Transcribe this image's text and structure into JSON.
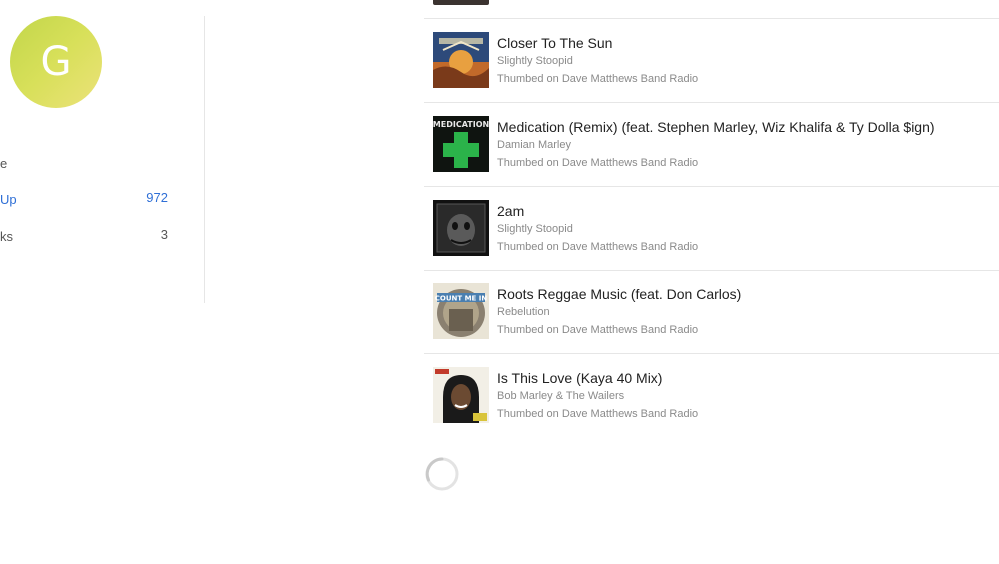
{
  "profile": {
    "initial": "G",
    "avatar_color": "#c9da4f"
  },
  "nav": [
    {
      "label": "e",
      "count": ""
    },
    {
      "label": "Up",
      "count": "972",
      "active": true
    },
    {
      "label": "ks",
      "count": "3"
    }
  ],
  "tracks": [
    {
      "title": "Closer To The Sun",
      "artist": "Slightly Stoopid",
      "meta": "Thumbed on Dave Matthews Band Radio"
    },
    {
      "title": "Medication (Remix) (feat. Stephen Marley, Wiz Khalifa & Ty Dolla $ign)",
      "artist": "Damian Marley",
      "meta": "Thumbed on Dave Matthews Band Radio"
    },
    {
      "title": "2am",
      "artist": "Slightly Stoopid",
      "meta": "Thumbed on Dave Matthews Band Radio"
    },
    {
      "title": "Roots Reggae Music (feat. Don Carlos)",
      "artist": "Rebelution",
      "meta": "Thumbed on Dave Matthews Band Radio"
    },
    {
      "title": "Is This Love (Kaya 40 Mix)",
      "artist": "Bob Marley & The Wailers",
      "meta": "Thumbed on Dave Matthews Band Radio"
    }
  ],
  "album_art_text": {
    "medication": "MEDICATION",
    "roots": "COUNT ME IN"
  },
  "colors": {
    "accent": "#2f6fd6",
    "divider": "#e6e6e6",
    "secondary_text": "#8a8a8a"
  },
  "loading": "loading-spinner-icon"
}
